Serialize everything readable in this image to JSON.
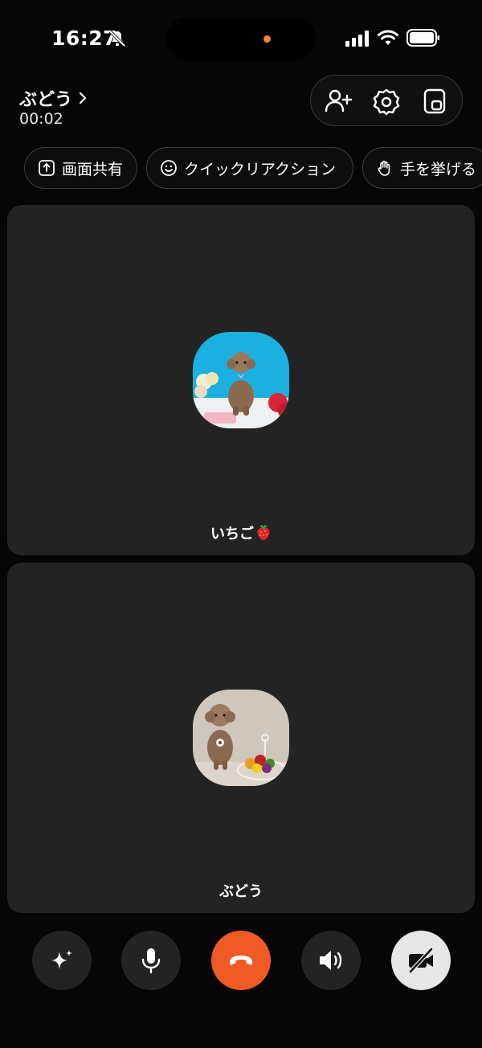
{
  "status_bar": {
    "time": "16:27"
  },
  "header": {
    "call_name": "ぶどう",
    "timer": "00:02"
  },
  "chips": [
    {
      "label": "画面共有",
      "icon": "share-screen-icon"
    },
    {
      "label": "クイックリアクション",
      "icon": "smiley-icon"
    },
    {
      "label": "手を挙げる",
      "icon": "raise-hand-icon"
    }
  ],
  "participants": [
    {
      "name": "いちご",
      "emoji": "strawberry-icon"
    },
    {
      "name": "ぶどう"
    }
  ],
  "controls": [
    "effects-sparkle-icon",
    "microphone-icon",
    "end-call-icon",
    "speaker-icon",
    "camera-off-icon"
  ],
  "colors": {
    "end_call": "#f05a24",
    "tile": "#232323",
    "background": "#060606",
    "indicator_dot": "#f0862e"
  }
}
